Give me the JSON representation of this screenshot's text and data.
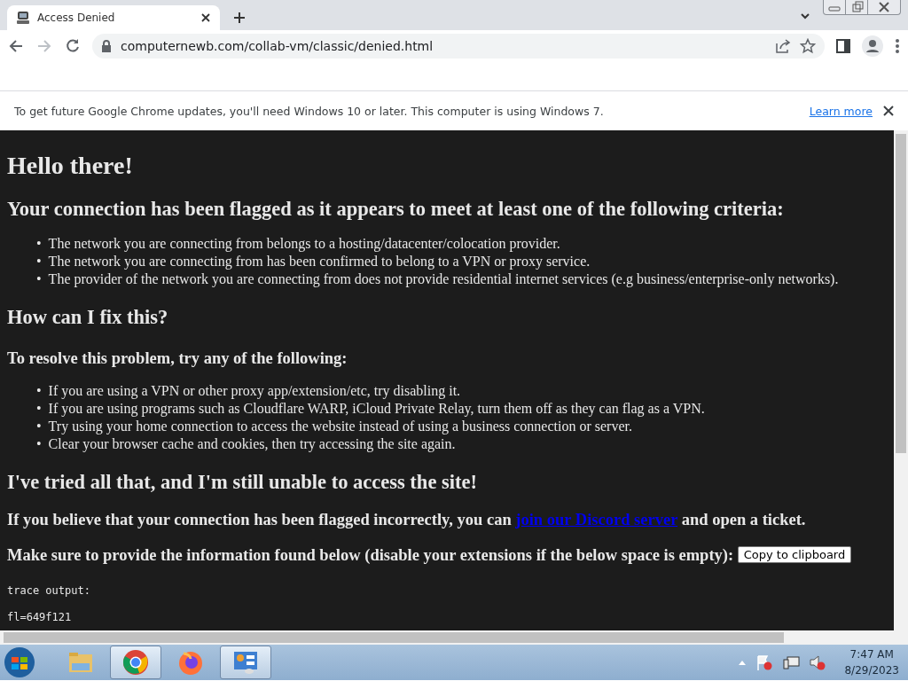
{
  "tab": {
    "title": "Access Denied",
    "selected": true
  },
  "address_bar": {
    "url": "computernewb.com/collab-vm/classic/denied.html"
  },
  "infobar": {
    "message": "To get future Google Chrome updates, you'll need Windows 10 or later. This computer is using Windows 7.",
    "link": "Learn more"
  },
  "page": {
    "title": "Hello there!",
    "sections": [
      {
        "kind": "h2",
        "text": "Your connection has been flagged as it appears to meet at least one of the following criteria:"
      },
      {
        "kind": "list",
        "marker": "•",
        "items": [
          "The network you are connecting from belongs to a hosting/datacenter/colocation provider.",
          "The network you are connecting from has been confirmed to belong to a VPN or proxy service.",
          "The provider of the network you are connecting from does not provide residential internet services (e.g business/enterprise-only networks)."
        ]
      },
      {
        "kind": "h2",
        "text": "How can I fix this?"
      },
      {
        "kind": "h3",
        "text": "To resolve this problem, try any of the following:"
      },
      {
        "kind": "list",
        "marker": "•",
        "items": [
          "If you are using a VPN or other proxy app/extension/etc, try disabling it.",
          "If you are using programs such as Cloudflare WARP, iCloud Private Relay, turn them off as they can flag as a VPN.",
          "Try using your home connection to access the website instead of using a business connection or server.",
          "Clear your browser cache and cookies, then try accessing the site again."
        ]
      },
      {
        "kind": "h2",
        "text": "I've tried all that, and I'm still unable to access the site!"
      },
      {
        "kind": "linkline",
        "before": "If you believe that your connection has been flagged incorrectly, you can",
        "link": "join our Discord server",
        "after": "and open a ticket."
      },
      {
        "kind": "buttonline",
        "text": "Make sure to provide the information found below (disable your extensions if the below space is empty):",
        "button": "Copy to clipboard"
      },
      {
        "kind": "pre",
        "lines": [
          "trace output:",
          "fl=649f121"
        ]
      }
    ]
  },
  "taskbar": {
    "apps": [
      {
        "kind": "explorer",
        "open": false
      },
      {
        "kind": "chrome",
        "open": true
      },
      {
        "kind": "firefox",
        "open": false
      },
      {
        "kind": "control-panel",
        "open": true
      }
    ],
    "time": "7:47 AM",
    "date": "8/29/2023"
  }
}
